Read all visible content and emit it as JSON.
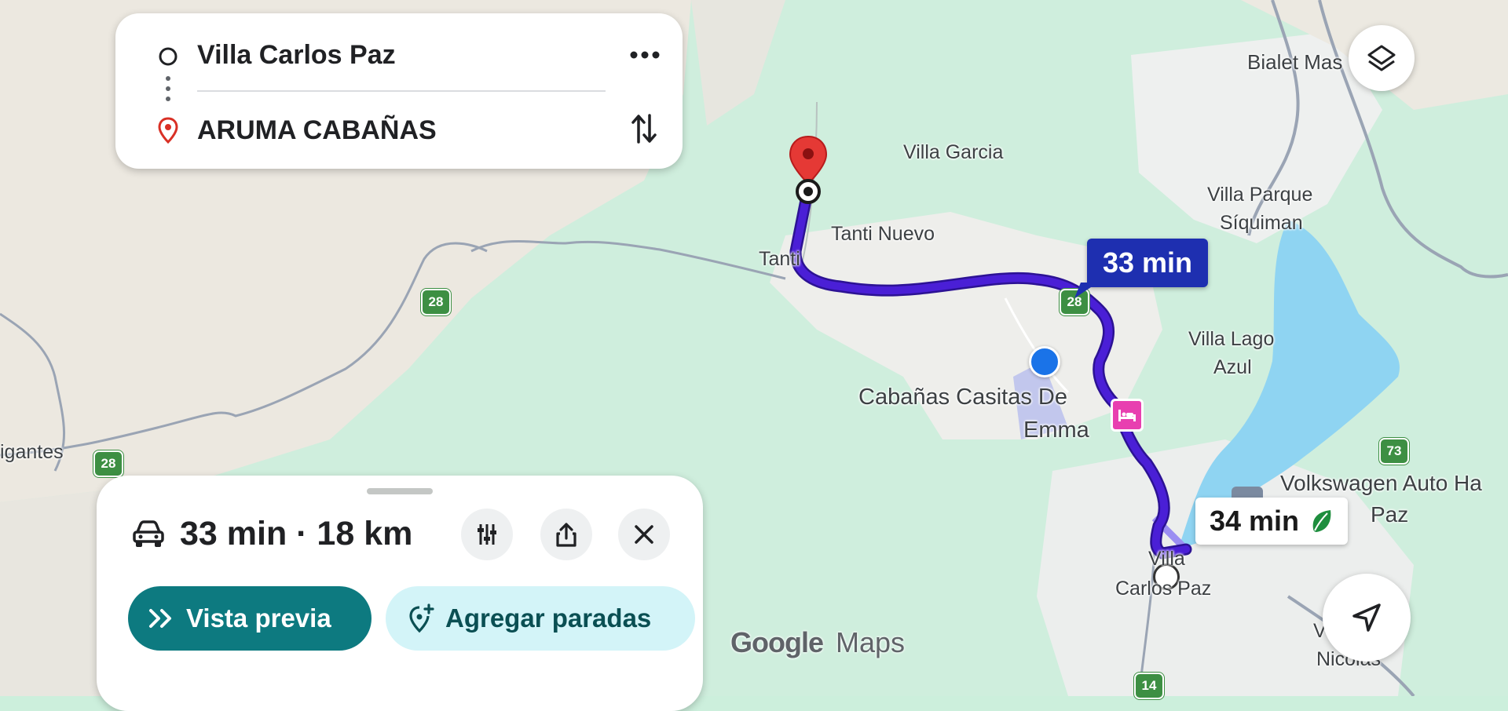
{
  "search_card": {
    "origin": "Villa Carlos Paz",
    "destination": "ARUMA CABAÑAS"
  },
  "map": {
    "labels": {
      "bialet": "Bialet Mas",
      "villa_garcia": "Villa Garcia",
      "villa_parque": "Villa Parque",
      "siquiman": "Síquiman",
      "tanti_nuevo": "Tanti Nuevo",
      "tanti": "Tanti",
      "villa_lago": "Villa Lago",
      "azul": "Azul",
      "cabanas_1": "Cabañas Casitas De",
      "cabanas_2": "Emma",
      "gigantes": "igantes",
      "volkswagen_1": "Volkswagen Auto Ha",
      "volkswagen_2": "Paz",
      "villa_1": "Villa",
      "villa_2": "Carlos Paz",
      "v_small": "V",
      "nicolas": "Nicolás"
    },
    "route_shields": {
      "r28_a": "28",
      "r28_b": "28",
      "r28_c": "28",
      "r73": "73",
      "r14": "14"
    },
    "route_color": "#4a1fd6",
    "water_color": "#8fd4f2",
    "main_time_bubble": "33 min",
    "alt_time_bubble": "34 min",
    "watermark_google": "Google",
    "watermark_maps": "Maps"
  },
  "sheet": {
    "summary": "33 min · 18 km",
    "preview_button": "Vista previa",
    "add_stops_button": "Agregar paradas",
    "accent": "#0d7a80",
    "secondary_bg": "#d3f4f8"
  }
}
